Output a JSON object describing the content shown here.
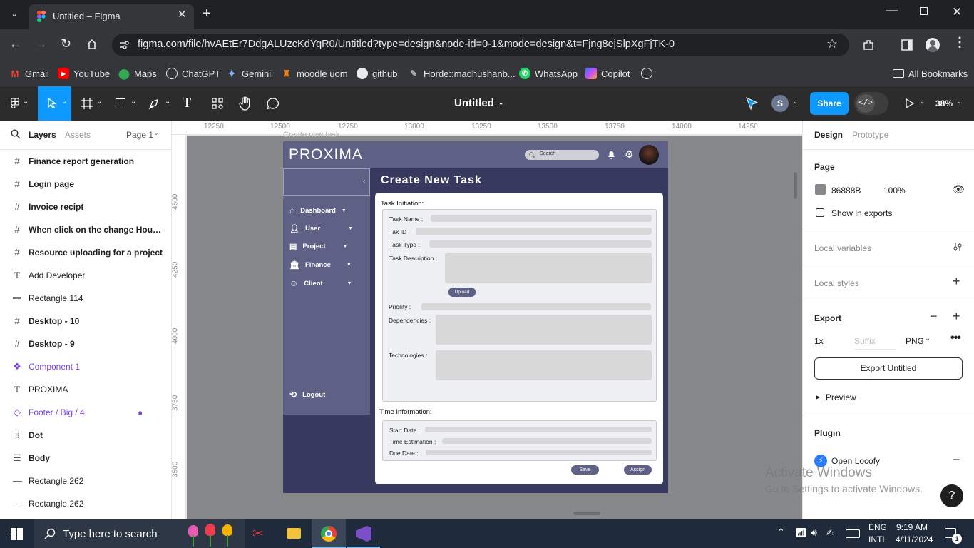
{
  "browser": {
    "tab_title": "Untitled – Figma",
    "url": "figma.com/file/hvAEtEr7DdgALUzcKdYqR0/Untitled?type=design&node-id=0-1&mode=design&t=Fjng8ejSlpXgFjTK-0",
    "bookmarks": [
      "Gmail",
      "YouTube",
      "Maps",
      "ChatGPT",
      "Gemini",
      "moodle uom",
      "github",
      "Horde::madhushanb...",
      "WhatsApp",
      "Copilot"
    ],
    "all_bookmarks": "All Bookmarks"
  },
  "figma": {
    "file_title": "Untitled",
    "user_initial": "S",
    "share": "Share",
    "zoom": "38%",
    "ruler_x": [
      "12250",
      "12500",
      "12750",
      "13000",
      "13250",
      "13500",
      "13750",
      "14000",
      "14250"
    ],
    "ruler_y": [
      "-4500",
      "-4250",
      "-4000",
      "-3750",
      "-3500"
    ],
    "frame_label": "Create new task"
  },
  "left_panel": {
    "tabs": [
      "Layers",
      "Assets"
    ],
    "page": "Page 1",
    "layers": [
      {
        "name": "Finance report generation",
        "type": "frame"
      },
      {
        "name": "Login page",
        "type": "frame"
      },
      {
        "name": "Invoice recipt",
        "type": "frame"
      },
      {
        "name": "When click on the change Hourly ...",
        "type": "frame"
      },
      {
        "name": "Resource uploading for a project",
        "type": "frame"
      },
      {
        "name": "Add Developer",
        "type": "text"
      },
      {
        "name": "Rectangle 114",
        "type": "rect"
      },
      {
        "name": "Desktop - 10",
        "type": "frame"
      },
      {
        "name": "Desktop - 9",
        "type": "frame"
      },
      {
        "name": "Component 1",
        "type": "component"
      },
      {
        "name": "PROXIMA",
        "type": "text"
      },
      {
        "name": "Footer / Big / 4",
        "type": "instance"
      },
      {
        "name": "Dot",
        "type": "autolayout"
      },
      {
        "name": "Body",
        "type": "list"
      },
      {
        "name": "Rectangle 262",
        "type": "rect"
      },
      {
        "name": "Rectangle 262",
        "type": "rect"
      }
    ]
  },
  "right_panel": {
    "tabs": [
      "Design",
      "Prototype"
    ],
    "page_heading": "Page",
    "page_color": "86888B",
    "page_opacity": "100%",
    "show_in_exports": "Show in exports",
    "local_variables": "Local variables",
    "local_styles": "Local styles",
    "export_heading": "Export",
    "export_scale": "1x",
    "export_suffix_placeholder": "Suffix",
    "export_format": "PNG",
    "export_button": "Export Untitled",
    "preview": "Preview",
    "plugin_heading": "Plugin",
    "plugin_name": "Open Locofy"
  },
  "watermark": {
    "line1": "Activate Windows",
    "line2": "Go to Settings to activate Windows."
  },
  "proxima": {
    "logo": "PROXIMA",
    "search_placeholder": "Search",
    "page_title": "Create New Task",
    "nav": [
      "Dashboard",
      "User",
      "Project",
      "Finance",
      "Client"
    ],
    "logout": "Logout",
    "section1": "Task Initiation:",
    "fields1": {
      "task_name": "Task Name :",
      "task_id": "Tak ID :",
      "task_type": "Task Type :",
      "task_desc": "Task Description :",
      "upload": "Upload",
      "priority": "Priority :",
      "dependencies": "Dependencies :",
      "technologies": "Technologies :"
    },
    "section2": "Time Information:",
    "fields2": {
      "start_date": "Start Date :",
      "time_est": "Time Estimation :",
      "due_date": "Due Date :"
    },
    "save": "Save",
    "assign": "Assign"
  },
  "taskbar": {
    "search_placeholder": "Type here to search",
    "lang1": "ENG",
    "lang2": "INTL",
    "time": "9:19 AM",
    "date": "4/11/2024",
    "notifications": "1"
  }
}
